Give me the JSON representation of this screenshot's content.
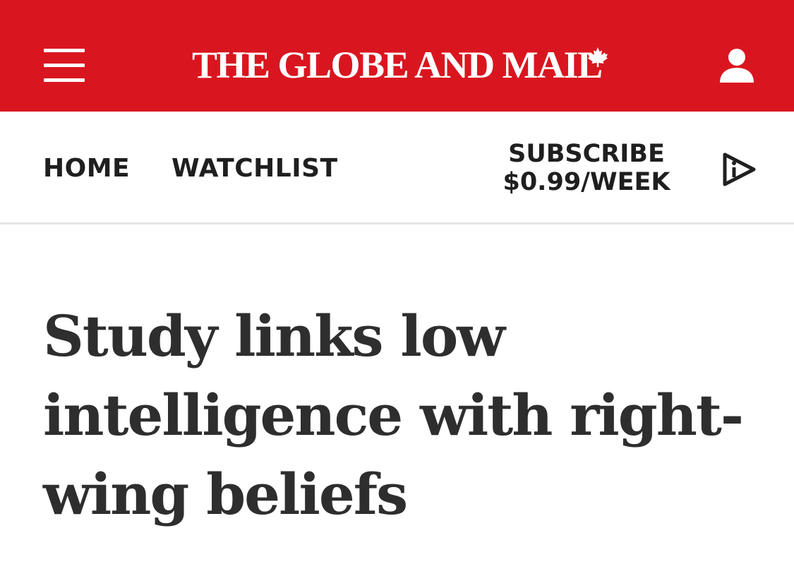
{
  "header": {
    "logo_text": "THE GLOBE AND MAIL",
    "brand_color": "#d9161f",
    "menu_icon": "hamburger-menu-icon",
    "account_icon": "user-account-icon",
    "logo_icon": "maple-leaf-icon"
  },
  "nav": {
    "home_label": "HOME",
    "watchlist_label": "WATCHLIST",
    "subscribe_line1": "SUBSCRIBE",
    "subscribe_line2": "$0.99/WEEK",
    "play_icon": "play-video-icon"
  },
  "article": {
    "headline_line1": "Study links low",
    "headline_line2": "intelligence with right-",
    "headline_line3": "wing beliefs"
  }
}
